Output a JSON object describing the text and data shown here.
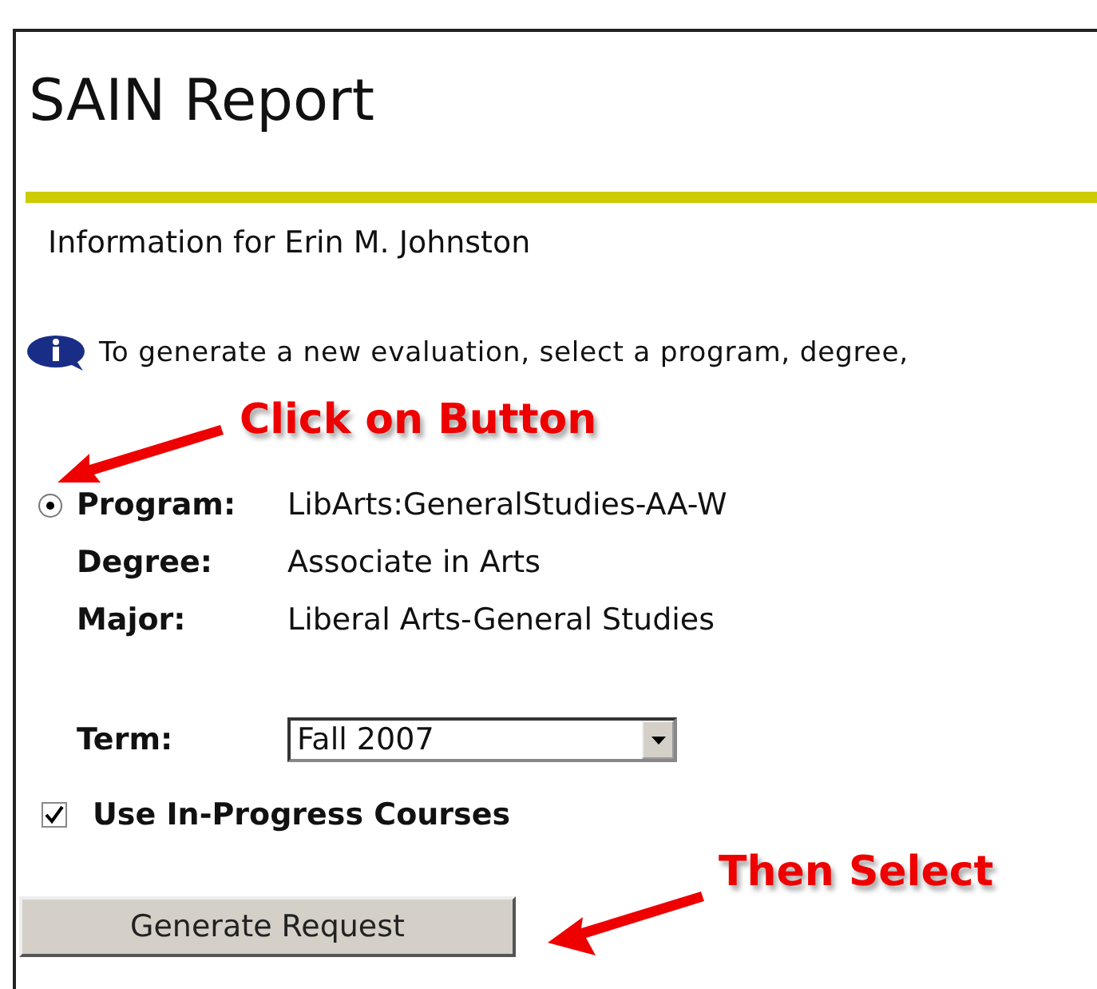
{
  "page": {
    "title": "SAIN Report",
    "subtitle": "Information for Erin M. Johnston"
  },
  "instruction": "To generate a new evaluation, select a program, degree,",
  "program_option": {
    "selected": true
  },
  "details": [
    {
      "label": "Program:",
      "value": "LibArts:GeneralStudies-AA-W"
    },
    {
      "label": "Degree:",
      "value": "Associate in Arts"
    },
    {
      "label": "Major:",
      "value": "Liberal Arts-General Studies"
    }
  ],
  "term": {
    "label": "Term:",
    "value": "Fall 2007"
  },
  "in_progress": {
    "label": "Use In-Progress Courses",
    "checked": true
  },
  "submit": {
    "label": "Generate Request"
  },
  "annotations": [
    {
      "text": "Click on Button"
    },
    {
      "text": "Then Select"
    }
  ]
}
